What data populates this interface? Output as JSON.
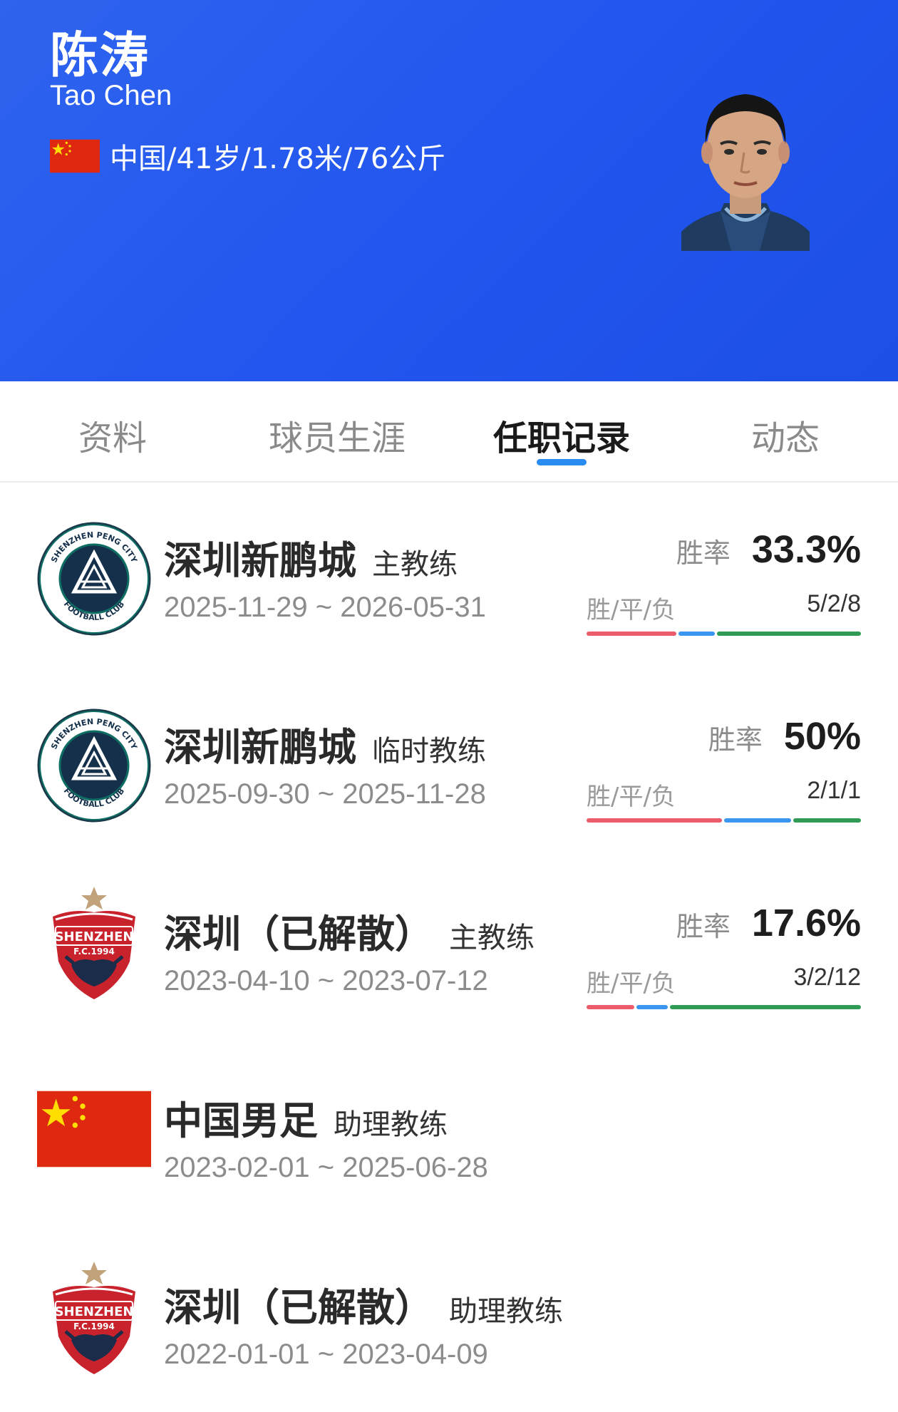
{
  "profile": {
    "name_cn": "陈涛",
    "name_en": "Tao Chen",
    "info": "中国/41岁/1.78米/76公斤",
    "flag_icon": "china-flag-icon",
    "header_color": "#2256ee"
  },
  "tabs": [
    {
      "label": "资料",
      "active": false
    },
    {
      "label": "球员生涯",
      "active": false
    },
    {
      "label": "任职记录",
      "active": true
    },
    {
      "label": "动态",
      "active": false
    }
  ],
  "records": [
    {
      "team": "深圳新鹏城",
      "role": "主教练",
      "dates": "2025-11-29 ~ 2026-05-31",
      "logo": "shenzhen-peng-city-logo",
      "winrate_label": "胜率",
      "winrate": "33.3%",
      "wdl_label": "胜/平/负",
      "wdl": "5/2/8",
      "win": 5,
      "draw": 2,
      "loss": 8
    },
    {
      "team": "深圳新鹏城",
      "role": "临时教练",
      "dates": "2025-09-30 ~ 2025-11-28",
      "logo": "shenzhen-peng-city-logo",
      "winrate_label": "胜率",
      "winrate": "50%",
      "wdl_label": "胜/平/负",
      "wdl": "2/1/1",
      "win": 2,
      "draw": 1,
      "loss": 1
    },
    {
      "team": "深圳（已解散）",
      "role": "主教练",
      "dates": "2023-04-10 ~ 2023-07-12",
      "logo": "shenzhen-fc-logo",
      "winrate_label": "胜率",
      "winrate": "17.6%",
      "wdl_label": "胜/平/负",
      "wdl": "3/2/12",
      "win": 3,
      "draw": 2,
      "loss": 12
    },
    {
      "team": "中国男足",
      "role": "助理教练",
      "dates": "2023-02-01 ~ 2025-06-28",
      "logo": "china-flag-icon"
    },
    {
      "team": "深圳（已解散）",
      "role": "助理教练",
      "dates": "2022-01-01 ~ 2023-04-09",
      "logo": "shenzhen-fc-logo"
    }
  ],
  "logo_text": {
    "peng_city_top": "SHENZHEN PENG CITY",
    "peng_city_bottom": "FOOTBALL CLUB",
    "shenzhen_fc_name": "SHENZHEN",
    "shenzhen_fc_year": "F.C.1994"
  },
  "colors": {
    "win": "#ec5c6a",
    "draw": "#3a96ee",
    "loss": "#2f9b54",
    "tab_indicator": "#2a8cf0"
  }
}
